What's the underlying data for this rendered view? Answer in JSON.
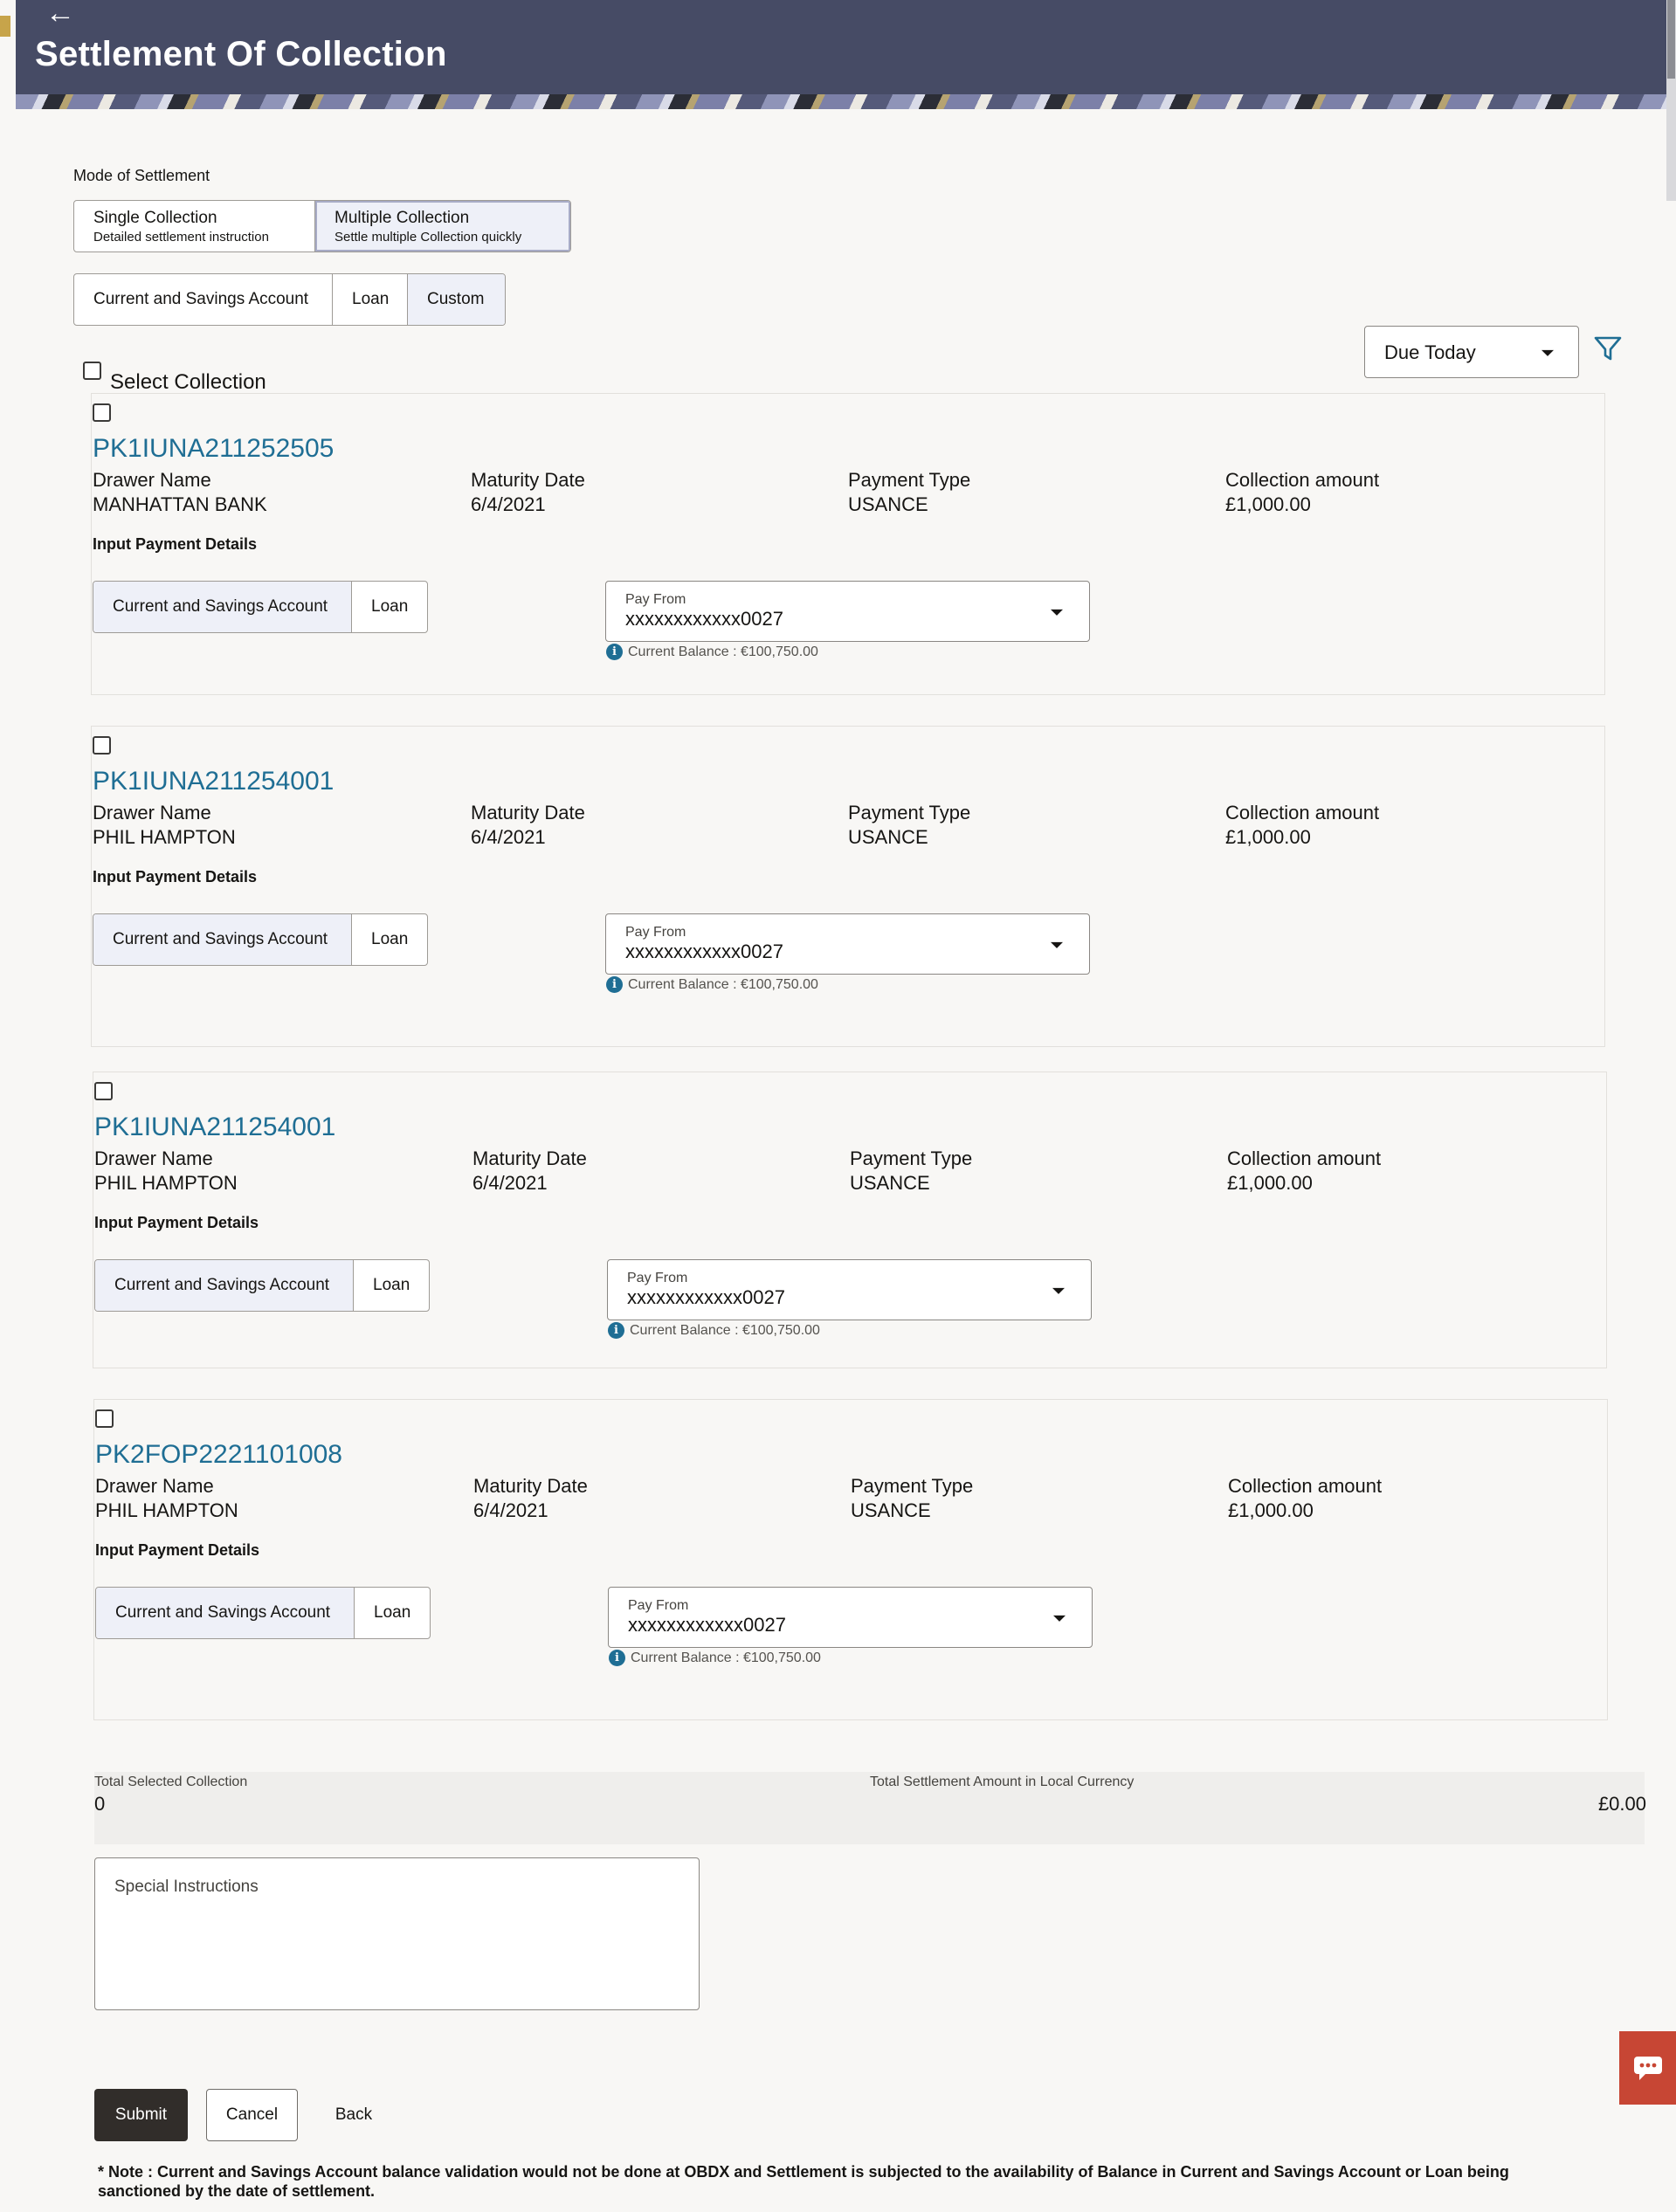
{
  "header": {
    "back_icon": "arrow-left-icon",
    "title": "Settlement Of Collection"
  },
  "mode": {
    "label": "Mode of Settlement",
    "options": [
      {
        "label": "Single Collection",
        "sub": "Detailed settlement instruction"
      },
      {
        "label": "Multiple Collection",
        "sub": "Settle multiple Collection quickly"
      }
    ],
    "selected": "Multiple Collection"
  },
  "account_type": {
    "options": [
      "Current and Savings Account",
      "Loan",
      "Custom"
    ],
    "selected": "Custom"
  },
  "filter": {
    "value": "Due Today",
    "icon": "filter-icon"
  },
  "select_all_label": "Select Collection",
  "collections": [
    {
      "ref": "PK1IUNA211252505",
      "drawer_label": "Drawer Name",
      "drawer": "MANHATTAN BANK",
      "maturity_label": "Maturity Date",
      "maturity": "6/4/2021",
      "ptype_label": "Payment Type",
      "ptype": "USANCE",
      "amount_label": "Collection amount",
      "amount": "£1,000.00",
      "ipd_label": "Input Payment Details",
      "pay_options": [
        "Current and Savings Account",
        "Loan"
      ],
      "pay_from_label": "Pay From",
      "pay_from": "xxxxxxxxxxxx0027",
      "balance": "Current Balance : €100,750.00"
    },
    {
      "ref": "PK1IUNA211254001",
      "drawer_label": "Drawer Name",
      "drawer": "PHIL HAMPTON",
      "maturity_label": "Maturity Date",
      "maturity": "6/4/2021",
      "ptype_label": "Payment Type",
      "ptype": "USANCE",
      "amount_label": "Collection amount",
      "amount": "£1,000.00",
      "ipd_label": "Input Payment Details",
      "pay_options": [
        "Current and Savings Account",
        "Loan"
      ],
      "pay_from_label": "Pay From",
      "pay_from": "xxxxxxxxxxxx0027",
      "balance": "Current Balance : €100,750.00"
    },
    {
      "ref": "PK1IUNA211254001",
      "drawer_label": "Drawer Name",
      "drawer": "PHIL HAMPTON",
      "maturity_label": "Maturity Date",
      "maturity": "6/4/2021",
      "ptype_label": "Payment Type",
      "ptype": "USANCE",
      "amount_label": "Collection amount",
      "amount": "£1,000.00",
      "ipd_label": "Input Payment Details",
      "pay_options": [
        "Current and Savings Account",
        "Loan"
      ],
      "pay_from_label": "Pay From",
      "pay_from": "xxxxxxxxxxxx0027",
      "balance": "Current Balance : €100,750.00"
    },
    {
      "ref": "PK2FOP2221101008",
      "drawer_label": "Drawer Name",
      "drawer": "PHIL HAMPTON",
      "maturity_label": "Maturity Date",
      "maturity": "6/4/2021",
      "ptype_label": "Payment Type",
      "ptype": "USANCE",
      "amount_label": "Collection amount",
      "amount": "£1,000.00",
      "ipd_label": "Input Payment Details",
      "pay_options": [
        "Current and Savings Account",
        "Loan"
      ],
      "pay_from_label": "Pay From",
      "pay_from": "xxxxxxxxxxxx0027",
      "balance": "Current Balance : €100,750.00"
    }
  ],
  "totals": {
    "selected_label": "Total Selected Collection",
    "selected_value": "0",
    "amount_label": "Total Settlement Amount in Local Currency",
    "amount_value": "£0.00"
  },
  "special_instructions": {
    "label": "Special Instructions"
  },
  "actions": {
    "submit": "Submit",
    "cancel": "Cancel",
    "back": "Back"
  },
  "note": "* Note : Current and Savings Account balance validation would not be done at OBDX and Settlement is subjected to the availability of Balance in Current and Savings Account or Loan being sanctioned by the date of settlement.",
  "chat_icon": "chat-bubble-icon",
  "colors": {
    "header_bg": "#464b65",
    "link": "#1f6e94",
    "primary_button": "#312d2a",
    "chat": "#c74634"
  }
}
